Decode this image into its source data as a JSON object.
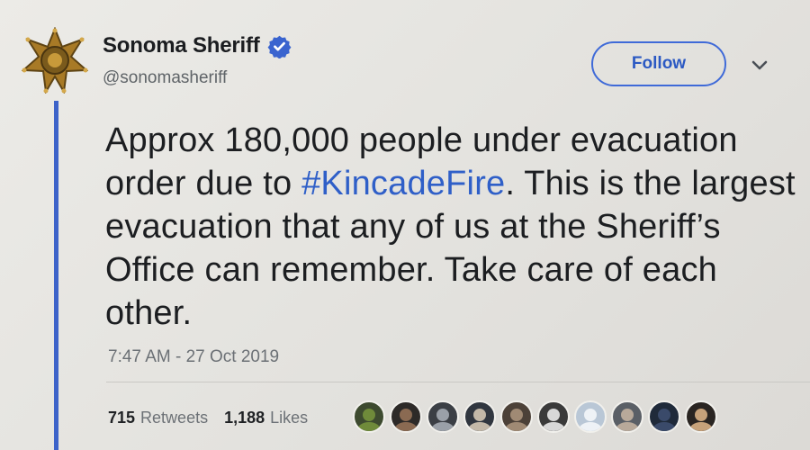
{
  "tweet": {
    "author": {
      "display_name": "Sonoma Sheriff",
      "handle": "@sonomasheriff",
      "verified": true,
      "avatar_icon": "sheriff-star-badge-icon"
    },
    "follow_label": "Follow",
    "menu_icon": "chevron-down-icon",
    "text_before": "Approx 180,000 people under evacuation order due to ",
    "hashtag": "#KincadeFire",
    "text_after": ". This is the largest evacuation that any of us at the Sheriff’s Office can remember. Take care of each other.",
    "timestamp": "7:47 AM - 27 Oct 2019",
    "retweets": {
      "count": "715",
      "label": "Retweets"
    },
    "likes": {
      "count": "1,188",
      "label": "Likes"
    },
    "liker_avatars": [
      {
        "bg": "#3d4a2f",
        "fg": "#6f8a3a"
      },
      {
        "bg": "#2d2a28",
        "fg": "#8a6a52"
      },
      {
        "bg": "#3b3f45",
        "fg": "#9aa0a8"
      },
      {
        "bg": "#30363f",
        "fg": "#c3b8a8"
      },
      {
        "bg": "#4c4138",
        "fg": "#a08a74"
      },
      {
        "bg": "#3a3a3a",
        "fg": "#d8d8d8"
      },
      {
        "bg": "#b9c7d6",
        "fg": "#eef2f6"
      },
      {
        "bg": "#5a5f66",
        "fg": "#b8a99a"
      },
      {
        "bg": "#1f2a3a",
        "fg": "#3a4a6a"
      },
      {
        "bg": "#2a2522",
        "fg": "#c7a27a"
      }
    ],
    "colors": {
      "accent": "#2f5fc8",
      "thread_line": "#3d63c9",
      "badge_gold": "#b8862b"
    }
  }
}
